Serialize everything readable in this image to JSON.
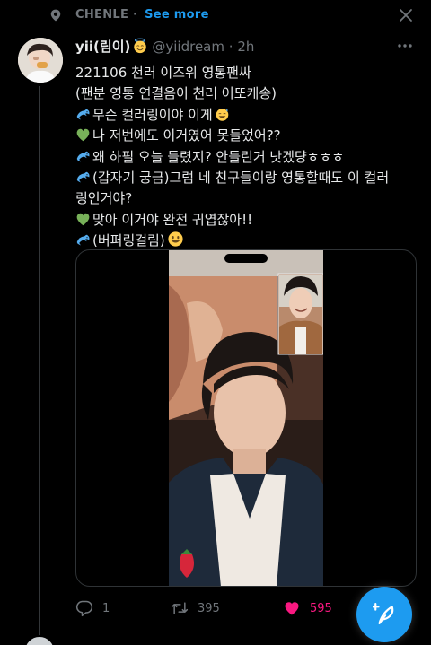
{
  "context": {
    "label": "CHENLE",
    "separator": "·",
    "see_more": "See more"
  },
  "tweet": {
    "display_name": "yii(림이)",
    "handle": "@yiidream",
    "separator": "·",
    "time": "2h",
    "lines": [
      "221106 천러 이즈위 영통팬싸",
      "(팬분 영통 연결음이 천러 어또케송)",
      "무슨 컬러링이야 이게",
      "나 저번에도 이거였어 못들었어??",
      "왜 하필 오늘 들렸지? 안들린거 낫겠댱ㅎㅎㅎ",
      "(갑자기 궁금)그럼 네 친구들이랑 영통할때도 이 컬러",
      "링인거야?",
      "맞아 이거야 완전 귀엽잖아!!",
      "(버퍼링걸림)"
    ],
    "emoji_names": [
      "dolphin",
      "green-heart",
      "smiling-face-with-sweat",
      "grinning-face",
      "smiling-face-with-halo"
    ]
  },
  "actions": {
    "replies": "1",
    "retweets": "395",
    "likes": "595"
  },
  "colors": {
    "background": "#000000",
    "text": "#e7e9ea",
    "muted": "#71767b",
    "accent": "#1d9bf0",
    "like": "#f91880",
    "heart_green": "#78b159",
    "dolphin": "#55acee",
    "emoji_yellow": "#ffcc4d"
  }
}
